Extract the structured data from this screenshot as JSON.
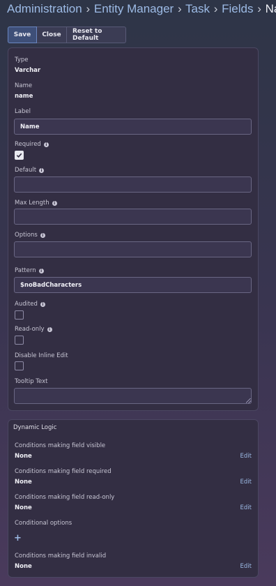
{
  "breadcrumb": {
    "items": [
      "Administration",
      "Entity Manager",
      "Task",
      "Fields"
    ],
    "current": "Name",
    "separator": "›"
  },
  "toolbar": {
    "save_label": "Save",
    "close_label": "Close",
    "reset_label": "Reset to Default"
  },
  "fields": {
    "type_label": "Type",
    "type_value": "Varchar",
    "name_label": "Name",
    "name_value": "name",
    "label_label": "Label",
    "label_value": "Name",
    "required_label": "Required",
    "required_checked": true,
    "default_label": "Default",
    "default_value": "",
    "maxlength_label": "Max Length",
    "maxlength_value": "",
    "options_label": "Options",
    "options_value": "",
    "pattern_label": "Pattern",
    "pattern_value": "$noBadCharacters",
    "audited_label": "Audited",
    "audited_checked": false,
    "readonly_label": "Read-only",
    "readonly_checked": false,
    "disable_inline_label": "Disable Inline Edit",
    "disable_inline_checked": false,
    "tooltip_label": "Tooltip Text",
    "tooltip_value": ""
  },
  "dynamic_logic": {
    "title": "Dynamic Logic",
    "visible_label": "Conditions making field visible",
    "visible_value": "None",
    "required_label": "Conditions making field required",
    "required_value": "None",
    "readonly_label": "Conditions making field read-only",
    "readonly_value": "None",
    "options_label": "Conditional options",
    "options_add": "+",
    "invalid_label": "Conditions making field invalid",
    "invalid_value": "None",
    "edit_label": "Edit"
  },
  "colors": {
    "accent": "#9dbbe6",
    "panel": "#332e43",
    "primary_button": "#3e4f78"
  }
}
